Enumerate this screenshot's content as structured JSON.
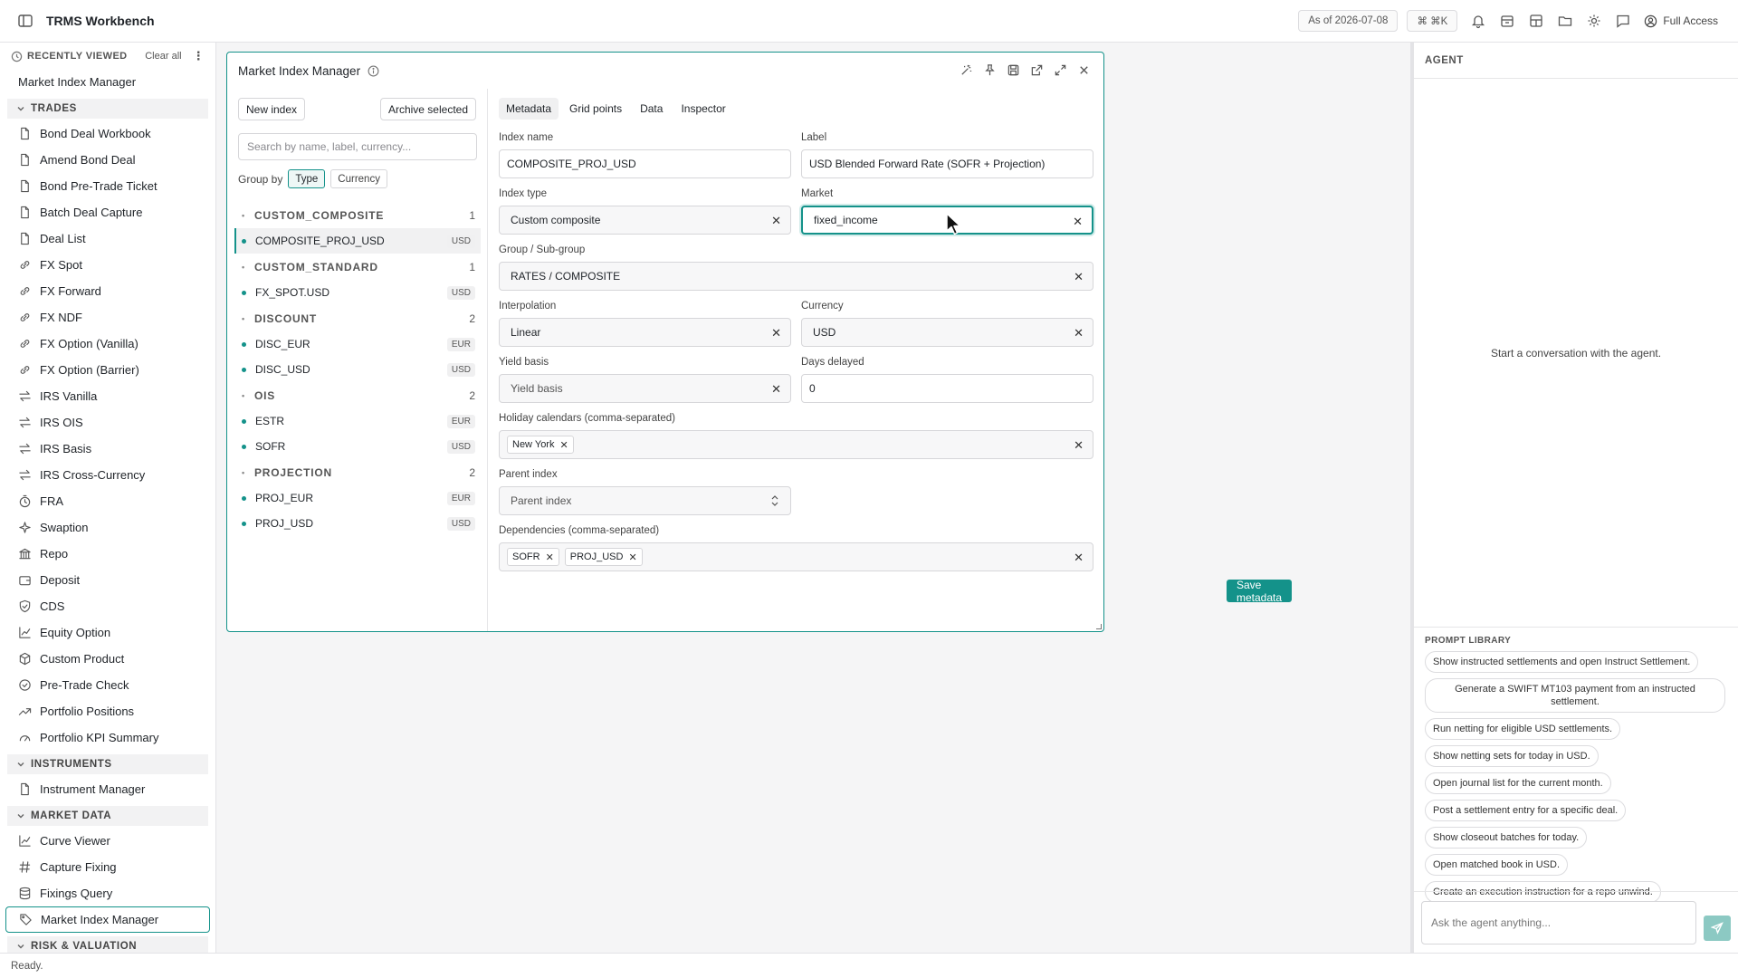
{
  "app": {
    "title": "TRMS Workbench",
    "as_of": "As of 2026-07-08",
    "shortcut": "⌘ ⌘K",
    "full_access": "Full Access",
    "status": "Ready."
  },
  "sidebar": {
    "recently_viewed": "RECENTLY VIEWED",
    "clear_all": "Clear all",
    "recent_items": [
      "Market Index Manager"
    ],
    "sections": [
      {
        "title": "TRADES",
        "items": [
          {
            "label": "Bond Deal Workbook",
            "icon": "document-icon"
          },
          {
            "label": "Amend Bond Deal",
            "icon": "document-icon"
          },
          {
            "label": "Bond Pre-Trade Ticket",
            "icon": "document-icon"
          },
          {
            "label": "Batch Deal Capture",
            "icon": "document-icon"
          },
          {
            "label": "Deal List",
            "icon": "document-icon"
          },
          {
            "label": "FX Spot",
            "icon": "link-icon"
          },
          {
            "label": "FX Forward",
            "icon": "link-icon"
          },
          {
            "label": "FX NDF",
            "icon": "link-icon"
          },
          {
            "label": "FX Option (Vanilla)",
            "icon": "link-icon"
          },
          {
            "label": "FX Option (Barrier)",
            "icon": "link-icon"
          },
          {
            "label": "IRS Vanilla",
            "icon": "swap-icon"
          },
          {
            "label": "IRS OIS",
            "icon": "swap-icon"
          },
          {
            "label": "IRS Basis",
            "icon": "swap-icon"
          },
          {
            "label": "IRS Cross-Currency",
            "icon": "swap-icon"
          },
          {
            "label": "FRA",
            "icon": "timer-icon"
          },
          {
            "label": "Swaption",
            "icon": "sparkle-icon"
          },
          {
            "label": "Repo",
            "icon": "bank-icon"
          },
          {
            "label": "Deposit",
            "icon": "wallet-icon"
          },
          {
            "label": "CDS",
            "icon": "shield-icon"
          },
          {
            "label": "Equity Option",
            "icon": "chart-line-icon"
          },
          {
            "label": "Custom Product",
            "icon": "cube-icon"
          },
          {
            "label": "Pre-Trade Check",
            "icon": "check-circle-icon"
          },
          {
            "label": "Portfolio Positions",
            "icon": "trend-up-icon"
          },
          {
            "label": "Portfolio KPI Summary",
            "icon": "gauge-icon"
          }
        ]
      },
      {
        "title": "INSTRUMENTS",
        "items": [
          {
            "label": "Instrument Manager",
            "icon": "document-icon"
          }
        ]
      },
      {
        "title": "MARKET DATA",
        "items": [
          {
            "label": "Curve Viewer",
            "icon": "chart-line-icon"
          },
          {
            "label": "Capture Fixing",
            "icon": "hash-icon"
          },
          {
            "label": "Fixings Query",
            "icon": "database-icon"
          },
          {
            "label": "Market Index Manager",
            "icon": "tag-icon",
            "active": true
          }
        ]
      },
      {
        "title": "RISK & VALUATION",
        "items": []
      }
    ]
  },
  "window": {
    "title": "Market Index Manager",
    "new_index": "New index",
    "archive_selected": "Archive selected",
    "search_placeholder": "Search by name, label, currency...",
    "group_by": "Group by",
    "group_by_options": [
      "Type",
      "Currency"
    ],
    "groups": [
      {
        "name": "CUSTOM_COMPOSITE",
        "count": "1",
        "items": [
          {
            "name": "COMPOSITE_PROJ_USD",
            "ccy": "USD",
            "selected": true
          }
        ]
      },
      {
        "name": "CUSTOM_STANDARD",
        "count": "1",
        "items": [
          {
            "name": "FX_SPOT.USD",
            "ccy": "USD"
          }
        ]
      },
      {
        "name": "DISCOUNT",
        "count": "2",
        "items": [
          {
            "name": "DISC_EUR",
            "ccy": "EUR"
          },
          {
            "name": "DISC_USD",
            "ccy": "USD"
          }
        ]
      },
      {
        "name": "OIS",
        "count": "2",
        "items": [
          {
            "name": "ESTR",
            "ccy": "EUR"
          },
          {
            "name": "SOFR",
            "ccy": "USD"
          }
        ]
      },
      {
        "name": "PROJECTION",
        "count": "2",
        "items": [
          {
            "name": "PROJ_EUR",
            "ccy": "EUR"
          },
          {
            "name": "PROJ_USD",
            "ccy": "USD"
          }
        ]
      }
    ],
    "tabs": [
      "Metadata",
      "Grid points",
      "Data",
      "Inspector"
    ],
    "form": {
      "index_name_label": "Index name",
      "index_name": "COMPOSITE_PROJ_USD",
      "label_label": "Label",
      "label": "USD Blended Forward Rate (SOFR + Projection)",
      "index_type_label": "Index type",
      "index_type": "Custom composite",
      "market_label": "Market",
      "market": "fixed_income",
      "group_label": "Group / Sub-group",
      "group": "RATES / COMPOSITE",
      "interpolation_label": "Interpolation",
      "interpolation": "Linear",
      "currency_label": "Currency",
      "currency": "USD",
      "yield_basis_label": "Yield basis",
      "yield_basis_placeholder": "Yield basis",
      "days_delayed_label": "Days delayed",
      "days_delayed": "0",
      "holiday_label": "Holiday calendars (comma-separated)",
      "holidays": [
        "New York"
      ],
      "parent_label": "Parent index",
      "parent_placeholder": "Parent index",
      "dependencies_label": "Dependencies (comma-separated)",
      "dependencies": [
        "SOFR",
        "PROJ_USD"
      ],
      "save": "Save metadata"
    }
  },
  "agent": {
    "title": "AGENT",
    "empty": "Start a conversation with the agent.",
    "prompt_library": "PROMPT LIBRARY",
    "prompts": [
      "Show instructed settlements and open Instruct Settlement.",
      "Generate a SWIFT MT103 payment from an instructed settlement.",
      "Run netting for eligible USD settlements.",
      "Show netting sets for today in USD.",
      "Open journal list for the current month.",
      "Post a settlement entry for a specific deal.",
      "Show closeout batches for today.",
      "Open matched book in USD.",
      "Create an execution instruction for a repo unwind."
    ],
    "input_placeholder": "Ask the agent anything..."
  },
  "colors": {
    "accent": "#14928a"
  }
}
